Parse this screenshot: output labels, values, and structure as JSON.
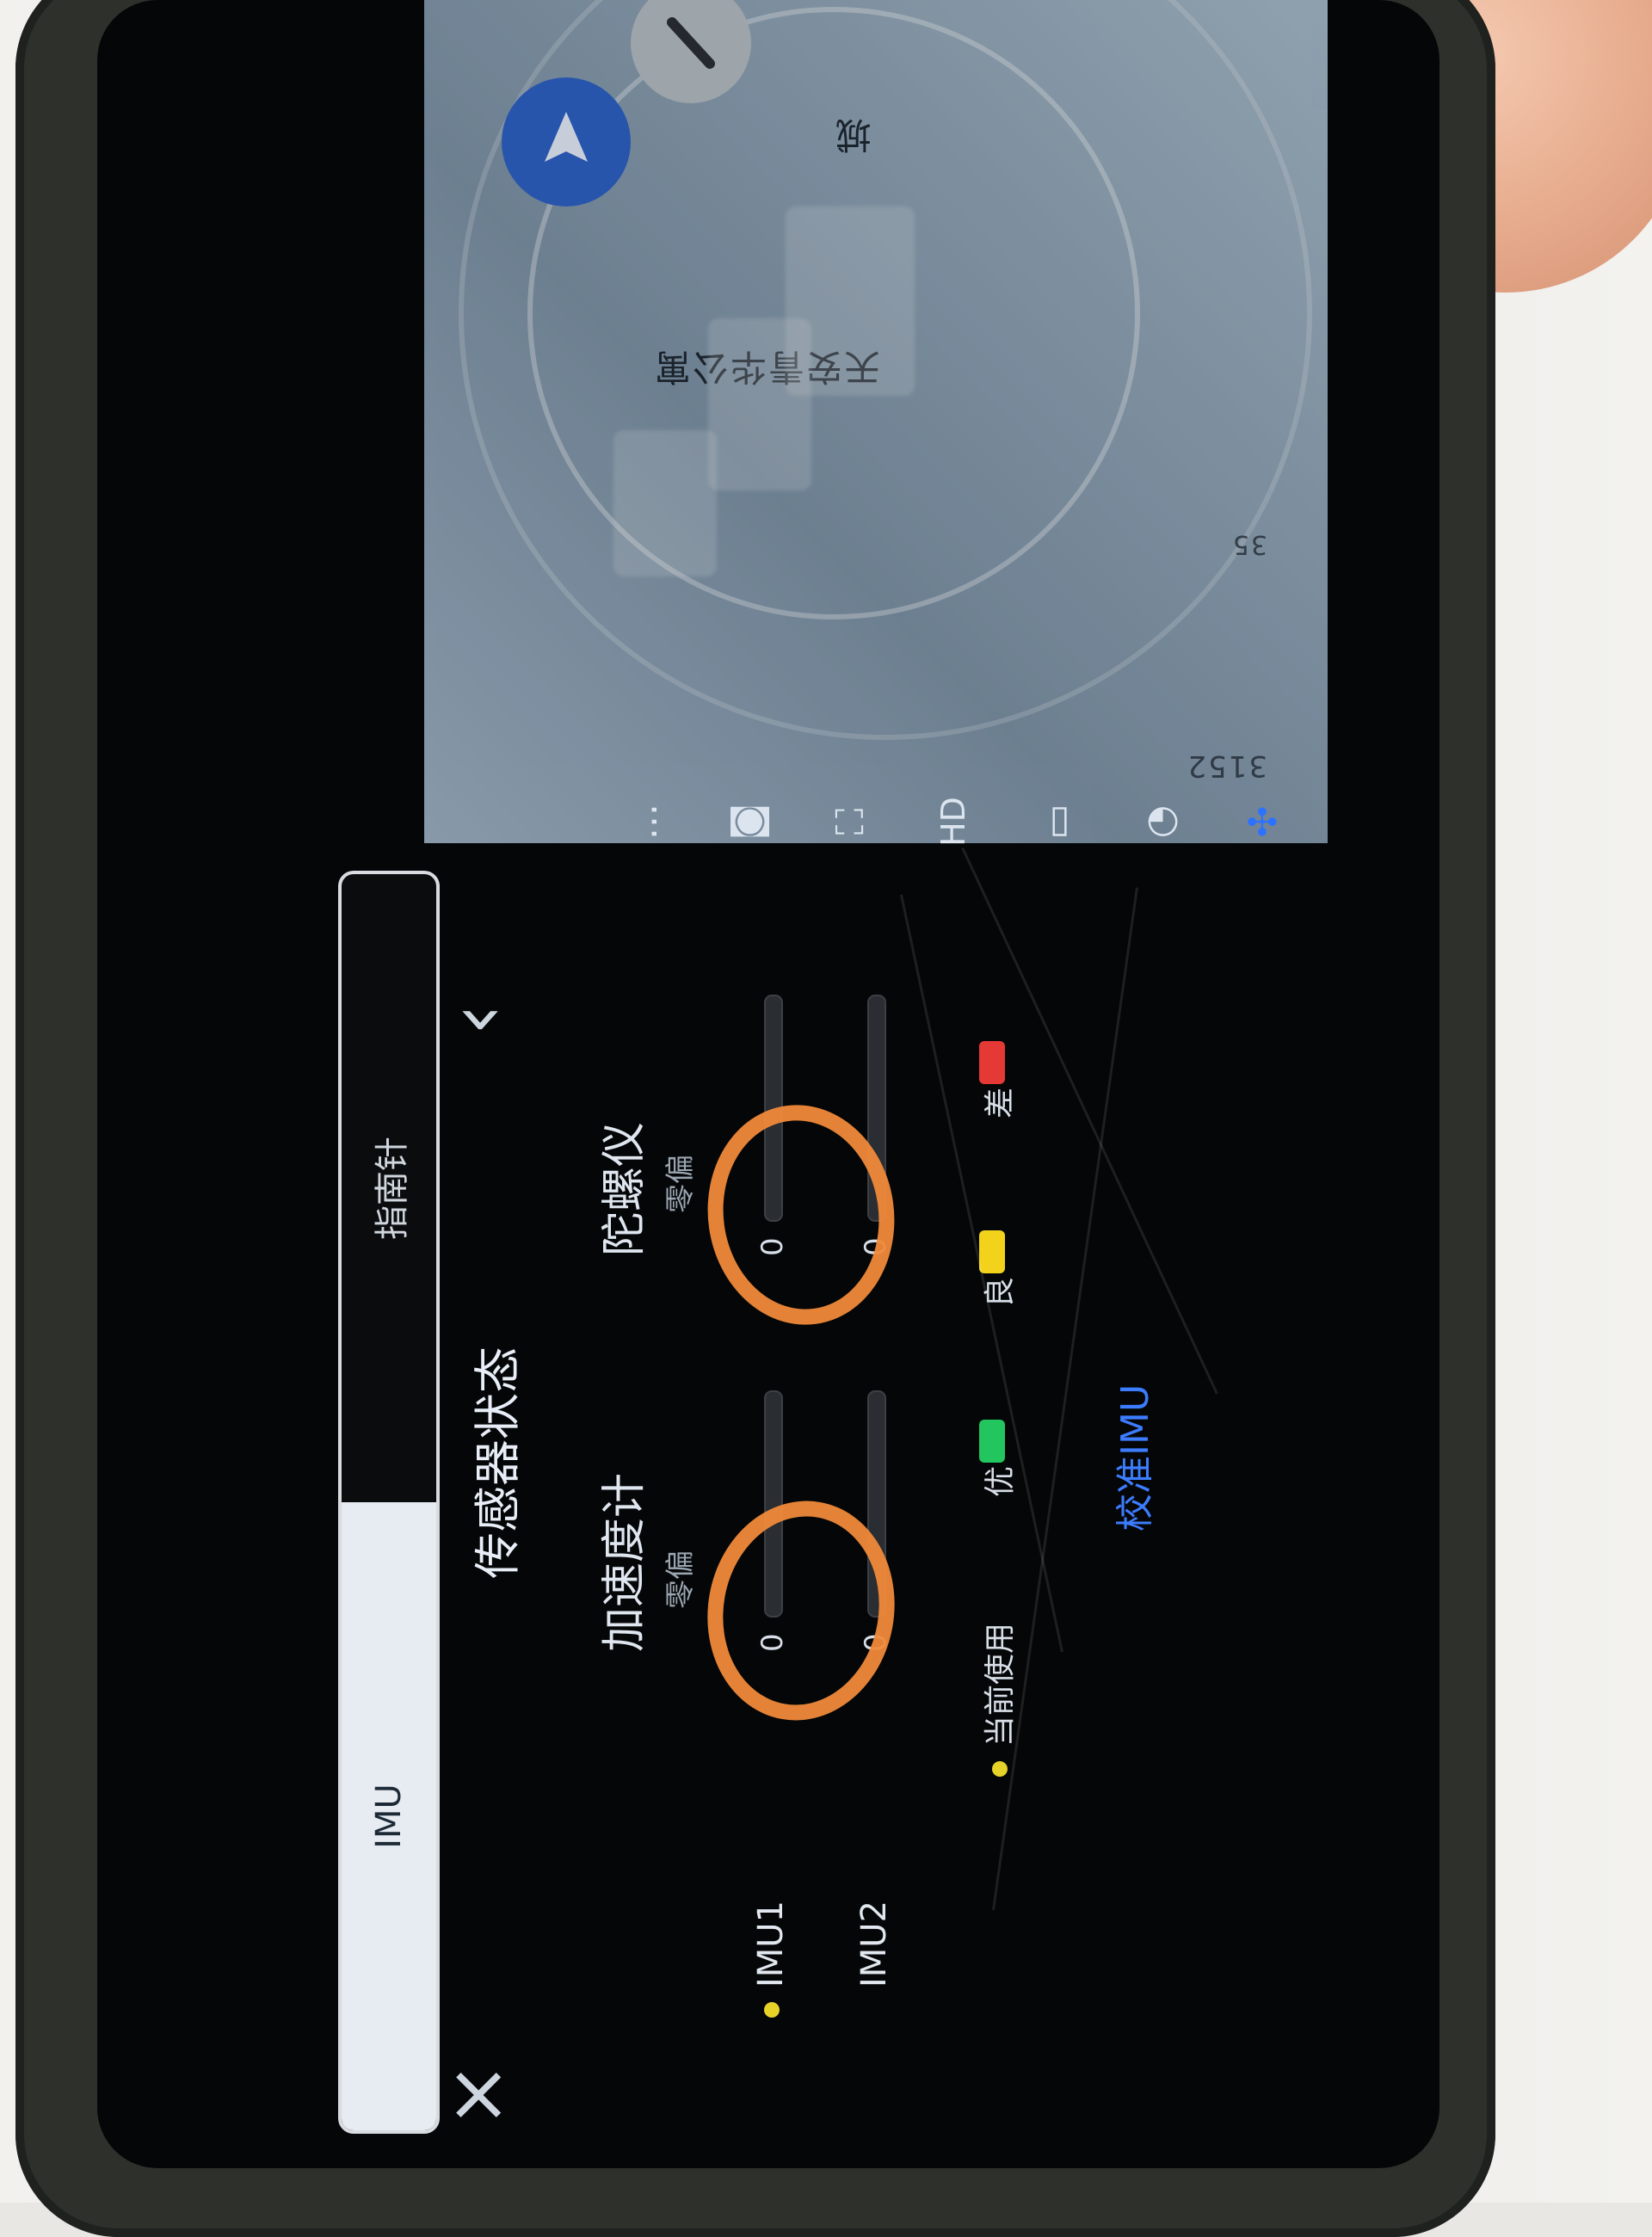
{
  "map": {
    "place_label": "天安青华公寓",
    "road_label": "城",
    "distance_label_1": "3152",
    "distance_label_2": "35"
  },
  "header": {
    "title": "传感器状态",
    "back_icon": "chevron-left-icon",
    "close_icon": "close-icon"
  },
  "tabs": [
    {
      "label": "IMU",
      "active": true
    },
    {
      "label": "指南针",
      "active": false
    }
  ],
  "imu": {
    "columns": {
      "accel": {
        "title": "加速度计",
        "subtitle": "零偏"
      },
      "gyro": {
        "title": "陀螺仪",
        "subtitle": "零偏"
      }
    },
    "rows": [
      {
        "name": "IMU1",
        "accel_value": "0",
        "gyro_value": "0",
        "in_use": true
      },
      {
        "name": "IMU2",
        "accel_value": "0",
        "gyro_value": "0",
        "in_use": false
      }
    ],
    "legend": {
      "current": "当前使用",
      "good": "优",
      "ok": "良",
      "bad": "差"
    },
    "calibrate": "校准IMU"
  },
  "sidebar": {
    "icons": [
      "aircraft-icon",
      "signal-icon",
      "battery-icon",
      "hd-icon",
      "camera-mode-icon",
      "camera-icon",
      "more-icon"
    ],
    "hd_label": "HD",
    "more_label": "..."
  },
  "colors": {
    "accent_blue": "#3c7cff",
    "good_green": "#22c55e",
    "ok_yellow": "#f2d21b",
    "bad_red": "#e53935",
    "orange_annotation": "#f08a3a"
  }
}
